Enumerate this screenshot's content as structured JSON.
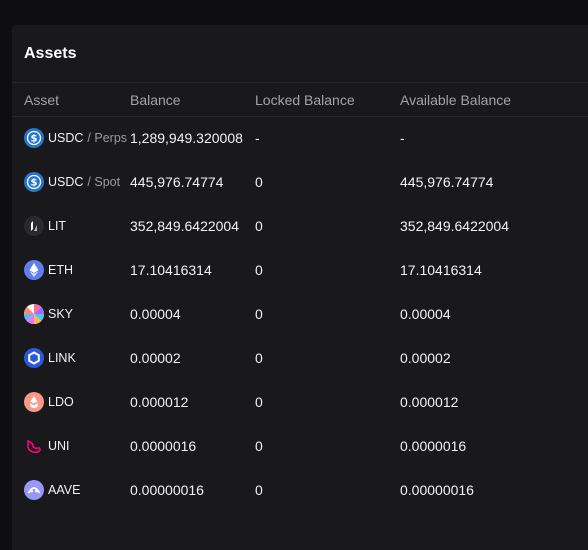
{
  "panel": {
    "title": "Assets"
  },
  "columns": {
    "asset": "Asset",
    "balance": "Balance",
    "locked": "Locked Balance",
    "available": "Available Balance"
  },
  "rows": [
    {
      "symbol": "USDC",
      "sub": "/ Perps",
      "balance": "1,289,949.320008",
      "locked": "-",
      "available": "-",
      "icon": "usdc-icon",
      "color": "#2775ca"
    },
    {
      "symbol": "USDC",
      "sub": "/ Spot",
      "balance": "445,976.74774",
      "locked": "0",
      "available": "445,976.74774",
      "icon": "usdc-icon",
      "color": "#2775ca"
    },
    {
      "symbol": "LIT",
      "sub": "",
      "balance": "352,849.6422004",
      "locked": "0",
      "available": "352,849.6422004",
      "icon": "lit-icon",
      "color": "#2a2a2e"
    },
    {
      "symbol": "ETH",
      "sub": "",
      "balance": "17.10416314",
      "locked": "0",
      "available": "17.10416314",
      "icon": "eth-icon",
      "color": "#627eea"
    },
    {
      "symbol": "SKY",
      "sub": "",
      "balance": "0.00004",
      "locked": "0",
      "available": "0.00004",
      "icon": "sky-icon",
      "color": "#ffffff"
    },
    {
      "symbol": "LINK",
      "sub": "",
      "balance": "0.00002",
      "locked": "0",
      "available": "0.00002",
      "icon": "link-icon",
      "color": "#2a5ada"
    },
    {
      "symbol": "LDO",
      "sub": "",
      "balance": "0.000012",
      "locked": "0",
      "available": "0.000012",
      "icon": "ldo-icon",
      "color": "#f69988"
    },
    {
      "symbol": "UNI",
      "sub": "",
      "balance": "0.0000016",
      "locked": "0",
      "available": "0.0000016",
      "icon": "uni-icon",
      "color": "#ff007a"
    },
    {
      "symbol": "AAVE",
      "sub": "",
      "balance": "0.00000016",
      "locked": "0",
      "available": "0.00000016",
      "icon": "aave-icon",
      "color": "#9896ff"
    }
  ]
}
